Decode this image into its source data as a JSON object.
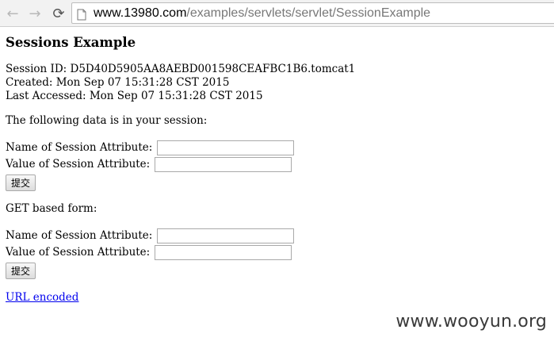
{
  "browser": {
    "url_host": "www.13980.com",
    "url_path": "/examples/servlets/servlet/SessionExample",
    "icons": {
      "back": "back-arrow-icon",
      "forward": "forward-arrow-icon",
      "reload": "reload-icon",
      "page": "page-icon"
    }
  },
  "page": {
    "title": "Sessions Example",
    "session_id": "Session ID: D5D40D5905AA8AEBD001598CEAFBC1B6.tomcat1",
    "created": "Created: Mon Sep 07 15:31:28 CST 2015",
    "last_accessed": "Last Accessed: Mon Sep 07 15:31:28 CST 2015",
    "session_data_heading": "The following data is in your session:",
    "post_form": {
      "name_label": "Name of Session Attribute:",
      "value_label": "Value of Session Attribute:",
      "name_value": "",
      "value_value": "",
      "submit_label": "提交"
    },
    "get_heading": "GET based form:",
    "get_form": {
      "name_label": "Name of Session Attribute:",
      "value_label": "Value of Session Attribute:",
      "name_value": "",
      "value_value": "",
      "submit_label": "提交"
    },
    "url_encoded_link": "URL encoded"
  },
  "watermark": "www.wooyun.org"
}
